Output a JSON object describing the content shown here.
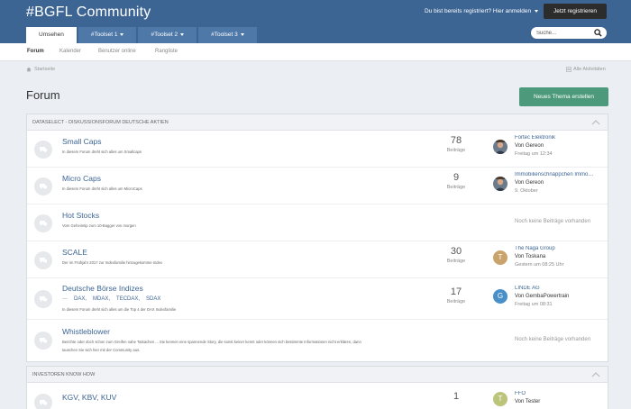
{
  "header": {
    "site_title": "#BGFL Community",
    "signin_text": "Du bist bereits registriert? Hier anmelden",
    "register_label": "Jetzt registrieren",
    "tabs": [
      {
        "label": "Umsehen",
        "has_caret": false
      },
      {
        "label": "#Toolset 1",
        "has_caret": true
      },
      {
        "label": "#Toolset 2",
        "has_caret": true
      },
      {
        "label": "#Toolset 3",
        "has_caret": true
      }
    ],
    "search_placeholder": "Suche..."
  },
  "subnav": [
    "Forum",
    "Kalender",
    "Benutzer online",
    "Rangliste"
  ],
  "breadcrumb": "Startseite",
  "activity_link": "Alle Aktivitäten",
  "page_title": "Forum",
  "new_topic_label": "Neues Thema erstellen",
  "sections": [
    {
      "title": "DATASELECT - DISKUSSIONSFORUM DEUTSCHE AKTIEN",
      "forums": [
        {
          "name": "Small Caps",
          "desc": "In diesem Forum dreht sich alles um Smallcaps",
          "count": "78",
          "count_label": "Beiträge",
          "last": {
            "title": "Fortec Elektronik",
            "by": "Von Gereon",
            "time": "Freitag um 12:34"
          }
        },
        {
          "name": "Micro Caps",
          "desc": "In diesem Forum dreht sich alles um MicroCaps",
          "count": "9",
          "count_label": "Beiträge",
          "last": {
            "title": "Immobilienschnäppchen Immo…",
            "by": "Von Gereon",
            "time": "9. Oktober"
          }
        },
        {
          "name": "Hot Stocks",
          "desc": "Vom Geheimtip zum 10-Bagger von morgen",
          "no_posts": "Noch keine Beiträge vorhanden"
        },
        {
          "name": "SCALE",
          "desc": "Der im Frühjahr 2017 zur Indexfamilie hinzugekomme Index",
          "count": "30",
          "count_label": "Beiträge",
          "last": {
            "title": "The Naga Group",
            "by": "Von Toskana",
            "time": "Gestern um 08:25 Uhr",
            "letter": "T"
          }
        },
        {
          "name": "Deutsche Börse Indizes",
          "subforums": [
            "DAX,",
            "MDAX,",
            "TECDAX,",
            "SDAX"
          ],
          "desc": "In diesem Forum dreht sich alles um die Top 4 der DAX Indexfamilie",
          "count": "17",
          "count_label": "Beiträge",
          "last": {
            "title": "LINDE AG",
            "by": "Von GembaPowertrain",
            "time": "Freitag um 08:31",
            "letter": "G"
          }
        },
        {
          "name": "Whistleblower",
          "desc": "Berichte oder doch schon zum Greifen nahe Tatsachen ... Sie kennen eine spannende Story, die sonst keiner kennt oder können sich bestimmte Informationen nicht erklären, dann",
          "desc2": "tauschen Sie sich hier mit der Community aus.",
          "no_posts": "Noch keine Beiträge vorhanden"
        }
      ]
    },
    {
      "title": "INVESTOREN KNOW HOW",
      "forums": [
        {
          "name": "KGV, KBV, KUV",
          "count": "1",
          "last": {
            "title": "FFO",
            "by": "Von Tester",
            "letter": "T"
          }
        }
      ]
    }
  ],
  "colors": {
    "header": "#3d6594",
    "accent_button": "#4c9a7b",
    "avatar_t": "#c9a36b",
    "avatar_g": "#4a90c8",
    "avatar_t2": "#bcc47a"
  }
}
